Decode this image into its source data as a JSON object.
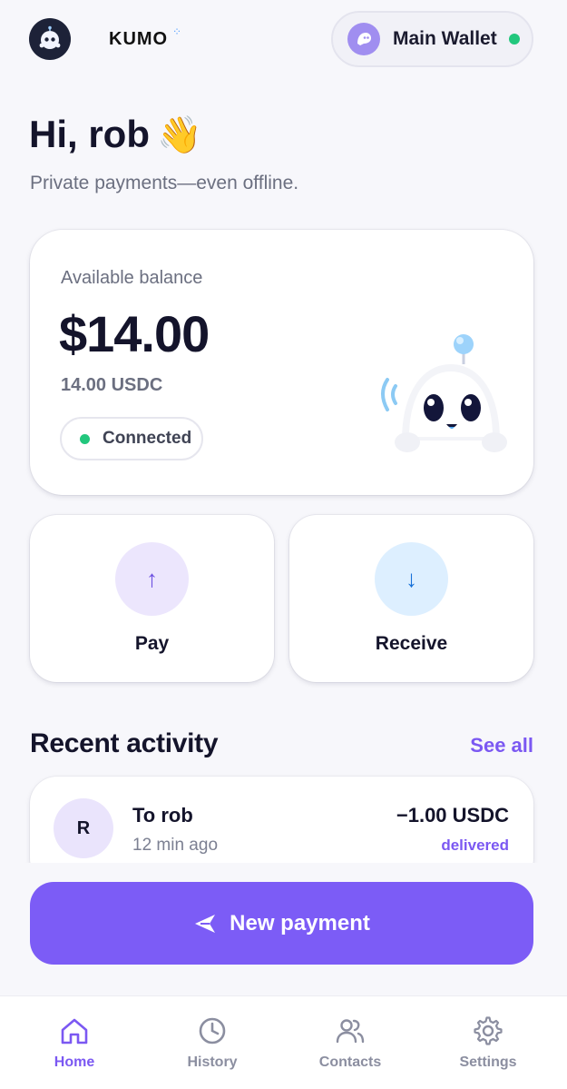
{
  "header": {
    "brand": "KUMO",
    "wallet_label": "Main Wallet"
  },
  "greeting": {
    "title": "Hi, rob",
    "emoji": "👋",
    "tagline": "Private payments—even offline."
  },
  "balance": {
    "label": "Available balance",
    "amount": "$14.00",
    "sub_amount": "14.00 USDC",
    "status": "Connected"
  },
  "actions": {
    "pay": {
      "icon": "↑",
      "label": "Pay"
    },
    "receive": {
      "icon": "↓",
      "label": "Receive"
    }
  },
  "recent": {
    "title": "Recent activity",
    "see_all": "See all",
    "items": [
      {
        "avatar": "R",
        "title": "To rob",
        "time": "12 min ago",
        "amount": "−1.00 USDC",
        "status": "delivered"
      }
    ]
  },
  "cta": {
    "label": "New payment"
  },
  "nav": {
    "items": [
      {
        "label": "Home",
        "icon": "home-icon",
        "active": true
      },
      {
        "label": "History",
        "icon": "clock-icon",
        "active": false
      },
      {
        "label": "Contacts",
        "icon": "users-icon",
        "active": false
      },
      {
        "label": "Settings",
        "icon": "gear-icon",
        "active": false
      }
    ]
  },
  "colors": {
    "accent": "#7c5cf6",
    "status_green": "#22c77d",
    "background": "#f7f7fb"
  }
}
